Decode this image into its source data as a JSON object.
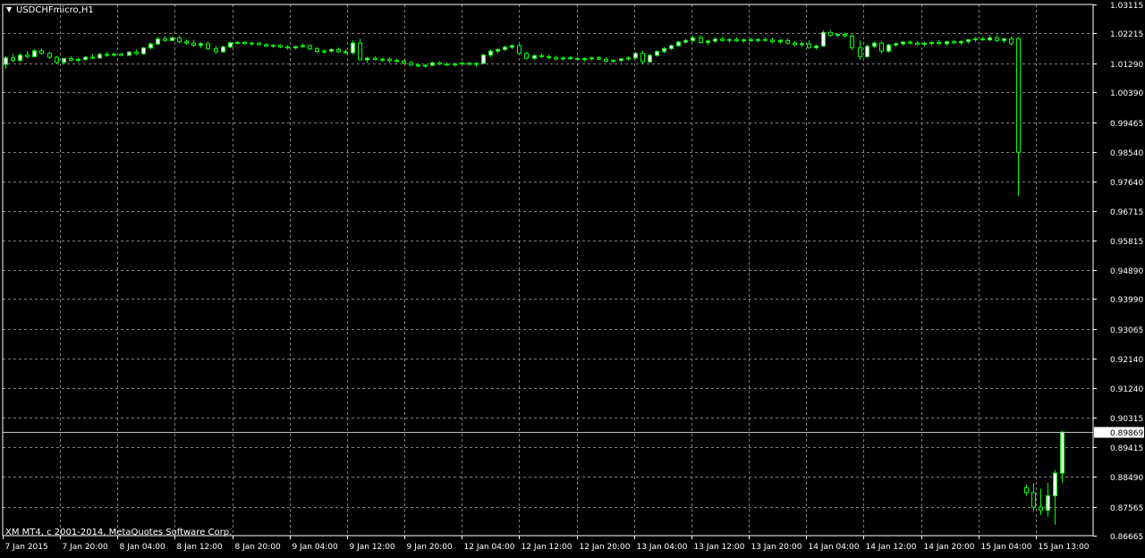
{
  "window": {
    "title": "USDCHFmicro,H1",
    "copyright": "XM MT4, c 2001-2014, MetaQuotes Software Corp."
  },
  "colors": {
    "background": "#000000",
    "grid": "#7f7f7f",
    "axis_text": "#ffffff",
    "bull_candle_fill": "#ffffff",
    "candle_outline": "#00ff00",
    "price_line": "#c0c0c0"
  },
  "chart_data": {
    "type": "candlestick",
    "symbol": "USDCHFmicro",
    "timeframe": "H1",
    "current_price": "0.89869",
    "grid": true,
    "ylim": [
      0.86665,
      1.03115
    ],
    "y_ticks": [
      "1.03115",
      "1.02215",
      "1.01290",
      "1.00390",
      "0.99465",
      "0.98540",
      "0.97640",
      "0.96715",
      "0.95815",
      "0.94890",
      "0.93990",
      "0.93065",
      "0.92140",
      "0.91240",
      "0.90315",
      "0.89415",
      "0.88490",
      "0.87565",
      "0.86665"
    ],
    "x_ticks": [
      "7 Jan 2015",
      "7 Jan 20:00",
      "8 Jan 04:00",
      "8 Jan 12:00",
      "8 Jan 20:00",
      "9 Jan 04:00",
      "9 Jan 12:00",
      "9 Jan 20:00",
      "12 Jan 04:00",
      "12 Jan 12:00",
      "12 Jan 20:00",
      "13 Jan 04:00",
      "13 Jan 12:00",
      "13 Jan 20:00",
      "14 Jan 04:00",
      "14 Jan 12:00",
      "14 Jan 20:00",
      "15 Jan 04:00",
      "15 Jan 13:00"
    ],
    "series": [
      {
        "ohlc": [
          [
            1.0126,
            1.0152,
            1.0112,
            1.0146
          ],
          [
            1.0146,
            1.0158,
            1.0132,
            1.0138
          ],
          [
            1.0138,
            1.0161,
            1.0135,
            1.0155
          ],
          [
            1.0155,
            1.0168,
            1.0145,
            1.015
          ],
          [
            1.015,
            1.0173,
            1.0148,
            1.0168
          ],
          [
            1.0168,
            1.0176,
            1.0156,
            1.016
          ],
          [
            1.016,
            1.0166,
            1.0143,
            1.0148
          ],
          [
            1.0148,
            1.0153,
            1.0128,
            1.0132
          ],
          [
            1.0132,
            1.0146,
            1.0126,
            1.0144
          ],
          [
            1.0144,
            1.0151,
            1.0136,
            1.0139
          ],
          [
            1.0139,
            1.0147,
            1.0134,
            1.0141
          ],
          [
            1.0141,
            1.0152,
            1.0138,
            1.0148
          ],
          [
            1.0148,
            1.0158,
            1.0143,
            1.0146
          ],
          [
            1.0146,
            1.0162,
            1.0143,
            1.0157
          ],
          [
            1.0157,
            1.0164,
            1.0149,
            1.0155
          ],
          [
            1.0155,
            1.0161,
            1.015,
            1.0158
          ],
          [
            1.0158,
            1.0162,
            1.0152,
            1.0154
          ],
          [
            1.0154,
            1.0167,
            1.0152,
            1.0164
          ],
          [
            1.0164,
            1.0172,
            1.0155,
            1.0159
          ],
          [
            1.0159,
            1.018,
            1.0156,
            1.0177
          ],
          [
            1.0177,
            1.0195,
            1.0172,
            1.0189
          ],
          [
            1.0189,
            1.0212,
            1.0185,
            1.0205
          ],
          [
            1.0205,
            1.0214,
            1.0196,
            1.02
          ],
          [
            1.02,
            1.0212,
            1.0198,
            1.0208
          ],
          [
            1.0208,
            1.0216,
            1.0192,
            1.0196
          ],
          [
            1.0196,
            1.0204,
            1.0186,
            1.0192
          ],
          [
            1.0192,
            1.0202,
            1.018,
            1.0185
          ],
          [
            1.0185,
            1.0195,
            1.0176,
            1.019
          ],
          [
            1.019,
            1.0196,
            1.017,
            1.0175
          ],
          [
            1.0175,
            1.0183,
            1.016,
            1.0165
          ],
          [
            1.0165,
            1.0184,
            1.0162,
            1.018
          ],
          [
            1.018,
            1.0197,
            1.0176,
            1.0193
          ],
          [
            1.0193,
            1.0198,
            1.0188,
            1.0194
          ],
          [
            1.0194,
            1.0198,
            1.0188,
            1.019
          ],
          [
            1.019,
            1.0196,
            1.0185,
            1.0192
          ],
          [
            1.0192,
            1.0195,
            1.0184,
            1.0187
          ],
          [
            1.0187,
            1.0191,
            1.018,
            1.0183
          ],
          [
            1.0183,
            1.0189,
            1.0176,
            1.0185
          ],
          [
            1.0185,
            1.0188,
            1.0176,
            1.018
          ],
          [
            1.018,
            1.0186,
            1.0172,
            1.0177
          ],
          [
            1.0177,
            1.0183,
            1.0172,
            1.0181
          ],
          [
            1.0181,
            1.019,
            1.0178,
            1.0184
          ],
          [
            1.0184,
            1.0188,
            1.017,
            1.0174
          ],
          [
            1.0174,
            1.018,
            1.0162,
            1.0166
          ],
          [
            1.0166,
            1.0172,
            1.016,
            1.0167
          ],
          [
            1.0167,
            1.0175,
            1.0163,
            1.0172
          ],
          [
            1.0172,
            1.0178,
            1.0162,
            1.0165
          ],
          [
            1.0165,
            1.0172,
            1.0157,
            1.0162
          ],
          [
            1.0162,
            1.02,
            1.0156,
            1.0192
          ],
          [
            1.0192,
            1.0205,
            1.015,
            1.014
          ],
          [
            1.014,
            1.0149,
            1.0132,
            1.0145
          ],
          [
            1.0145,
            1.0152,
            1.0138,
            1.0141
          ],
          [
            1.0141,
            1.0146,
            1.0134,
            1.0142
          ],
          [
            1.0142,
            1.0147,
            1.0132,
            1.0138
          ],
          [
            1.0138,
            1.0144,
            1.013,
            1.0136
          ],
          [
            1.0136,
            1.014,
            1.0126,
            1.0131
          ],
          [
            1.0131,
            1.0136,
            1.012,
            1.0124
          ],
          [
            1.0124,
            1.013,
            1.0117,
            1.0122
          ],
          [
            1.0122,
            1.0128,
            1.0116,
            1.0123
          ],
          [
            1.0123,
            1.0134,
            1.012,
            1.0131
          ],
          [
            1.0131,
            1.0136,
            1.0123,
            1.0127
          ],
          [
            1.0127,
            1.0132,
            1.012,
            1.0125
          ],
          [
            1.0125,
            1.0131,
            1.0119,
            1.0128
          ],
          [
            1.0128,
            1.0134,
            1.0124,
            1.013
          ],
          [
            1.013,
            1.0134,
            1.0122,
            1.0126
          ],
          [
            1.0126,
            1.0133,
            1.0118,
            1.0129
          ],
          [
            1.0129,
            1.016,
            1.0126,
            1.0155
          ],
          [
            1.0155,
            1.0172,
            1.0148,
            1.0167
          ],
          [
            1.0167,
            1.0177,
            1.016,
            1.0172
          ],
          [
            1.0172,
            1.0184,
            1.0167,
            1.0179
          ],
          [
            1.0179,
            1.0188,
            1.0173,
            1.0184
          ],
          [
            1.0184,
            1.019,
            1.0155,
            1.016
          ],
          [
            1.016,
            1.0165,
            1.014,
            1.0145
          ],
          [
            1.0145,
            1.0157,
            1.014,
            1.0153
          ],
          [
            1.0153,
            1.016,
            1.0145,
            1.015
          ],
          [
            1.015,
            1.0156,
            1.0142,
            1.0147
          ],
          [
            1.0147,
            1.0153,
            1.0138,
            1.0143
          ],
          [
            1.0143,
            1.015,
            1.0137,
            1.0146
          ],
          [
            1.0146,
            1.0152,
            1.014,
            1.0144
          ],
          [
            1.0144,
            1.015,
            1.0137,
            1.0141
          ],
          [
            1.0141,
            1.0147,
            1.0135,
            1.0144
          ],
          [
            1.0144,
            1.015,
            1.0138,
            1.0146
          ],
          [
            1.0146,
            1.0152,
            1.0139,
            1.0142
          ],
          [
            1.0142,
            1.0148,
            1.0133,
            1.0136
          ],
          [
            1.0136,
            1.0142,
            1.013,
            1.0138
          ],
          [
            1.0138,
            1.0145,
            1.0132,
            1.0143
          ],
          [
            1.0143,
            1.015,
            1.0137,
            1.0146
          ],
          [
            1.0146,
            1.0164,
            1.0142,
            1.016
          ],
          [
            1.016,
            1.0168,
            1.0128,
            1.0134
          ],
          [
            1.0134,
            1.0158,
            1.013,
            1.0154
          ],
          [
            1.0154,
            1.017,
            1.015,
            1.0166
          ],
          [
            1.0166,
            1.018,
            1.016,
            1.0175
          ],
          [
            1.0175,
            1.0188,
            1.017,
            1.0184
          ],
          [
            1.0184,
            1.0198,
            1.018,
            1.0195
          ],
          [
            1.0195,
            1.0205,
            1.019,
            1.02
          ],
          [
            1.02,
            1.0215,
            1.0194,
            1.0208
          ],
          [
            1.0208,
            1.0216,
            1.019,
            1.0194
          ],
          [
            1.0194,
            1.0202,
            1.0186,
            1.0198
          ],
          [
            1.0198,
            1.021,
            1.0192,
            1.0204
          ],
          [
            1.0204,
            1.0212,
            1.0196,
            1.02
          ],
          [
            1.02,
            1.0208,
            1.0193,
            1.0203
          ],
          [
            1.0203,
            1.021,
            1.0196,
            1.0199
          ],
          [
            1.0199,
            1.0206,
            1.0192,
            1.0202
          ],
          [
            1.0202,
            1.0208,
            1.0196,
            1.02
          ],
          [
            1.02,
            1.0207,
            1.0194,
            1.0203
          ],
          [
            1.0203,
            1.021,
            1.0196,
            1.0201
          ],
          [
            1.0201,
            1.0208,
            1.0192,
            1.0196
          ],
          [
            1.0196,
            1.0205,
            1.019,
            1.02
          ],
          [
            1.02,
            1.0206,
            1.0188,
            1.0192
          ],
          [
            1.0192,
            1.0198,
            1.0182,
            1.0187
          ],
          [
            1.0187,
            1.0196,
            1.018,
            1.019
          ],
          [
            1.019,
            1.02,
            1.0174,
            1.0178
          ],
          [
            1.0178,
            1.0187,
            1.0172,
            1.0183
          ],
          [
            1.0183,
            1.0232,
            1.018,
            1.0225
          ],
          [
            1.0225,
            1.023,
            1.0212,
            1.0216
          ],
          [
            1.0216,
            1.0222,
            1.021,
            1.0219
          ],
          [
            1.0219,
            1.0224,
            1.021,
            1.0214
          ],
          [
            1.0214,
            1.0219,
            1.017,
            1.0178
          ],
          [
            1.0178,
            1.02,
            1.014,
            1.015
          ],
          [
            1.015,
            1.0188,
            1.0145,
            1.0182
          ],
          [
            1.0182,
            1.0196,
            1.0177,
            1.0192
          ],
          [
            1.0192,
            1.0198,
            1.016,
            1.0167
          ],
          [
            1.0167,
            1.019,
            1.0162,
            1.0186
          ],
          [
            1.0186,
            1.0194,
            1.018,
            1.019
          ],
          [
            1.019,
            1.0198,
            1.0184,
            1.0195
          ],
          [
            1.0195,
            1.02,
            1.0187,
            1.0192
          ],
          [
            1.0192,
            1.0198,
            1.0184,
            1.0188
          ],
          [
            1.0188,
            1.0196,
            1.0182,
            1.0191
          ],
          [
            1.0191,
            1.0197,
            1.0185,
            1.0194
          ],
          [
            1.0194,
            1.02,
            1.0186,
            1.019
          ],
          [
            1.019,
            1.0199,
            1.0184,
            1.0196
          ],
          [
            1.0196,
            1.0202,
            1.0189,
            1.0193
          ],
          [
            1.0193,
            1.02,
            1.0186,
            1.0197
          ],
          [
            1.0197,
            1.0205,
            1.019,
            1.0202
          ],
          [
            1.0202,
            1.021,
            1.0196,
            1.0205
          ],
          [
            1.0205,
            1.0211,
            1.0198,
            1.0202
          ],
          [
            1.0202,
            1.0216,
            1.0197,
            1.0208
          ],
          [
            1.0208,
            1.0216,
            1.0195,
            1.02
          ],
          [
            1.02,
            1.0208,
            1.0192,
            1.0205
          ],
          [
            1.0205,
            1.0212,
            1.0185,
            1.019
          ],
          [
            1.0206,
            1.021,
            0.9718,
            0.9854
          ],
          [
            0.8815,
            0.8825,
            0.879,
            0.88
          ],
          [
            0.88,
            0.883,
            0.874,
            0.8755
          ],
          [
            0.8755,
            0.8812,
            0.873,
            0.8745
          ],
          [
            0.8745,
            0.883,
            0.8725,
            0.879
          ],
          [
            0.879,
            0.887,
            0.87,
            0.886
          ],
          [
            0.886,
            0.899,
            0.883,
            0.8987
          ]
        ]
      }
    ]
  }
}
